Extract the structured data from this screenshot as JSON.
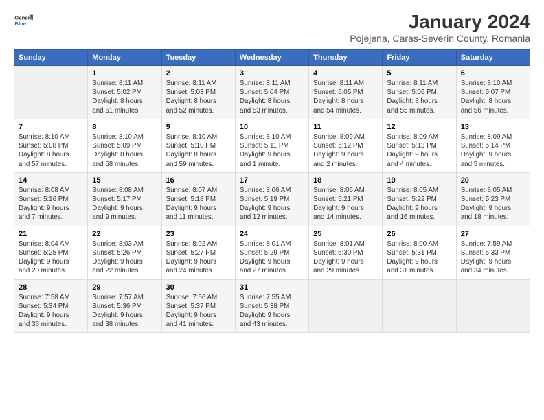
{
  "logo": {
    "general": "General",
    "blue": "Blue"
  },
  "title": "January 2024",
  "subtitle": "Pojejena, Caras-Severin County, Romania",
  "headers": [
    "Sunday",
    "Monday",
    "Tuesday",
    "Wednesday",
    "Thursday",
    "Friday",
    "Saturday"
  ],
  "weeks": [
    [
      {
        "num": "",
        "info": ""
      },
      {
        "num": "1",
        "info": "Sunrise: 8:11 AM\nSunset: 5:02 PM\nDaylight: 8 hours\nand 51 minutes."
      },
      {
        "num": "2",
        "info": "Sunrise: 8:11 AM\nSunset: 5:03 PM\nDaylight: 8 hours\nand 52 minutes."
      },
      {
        "num": "3",
        "info": "Sunrise: 8:11 AM\nSunset: 5:04 PM\nDaylight: 8 hours\nand 53 minutes."
      },
      {
        "num": "4",
        "info": "Sunrise: 8:11 AM\nSunset: 5:05 PM\nDaylight: 8 hours\nand 54 minutes."
      },
      {
        "num": "5",
        "info": "Sunrise: 8:11 AM\nSunset: 5:06 PM\nDaylight: 8 hours\nand 55 minutes."
      },
      {
        "num": "6",
        "info": "Sunrise: 8:10 AM\nSunset: 5:07 PM\nDaylight: 8 hours\nand 56 minutes."
      }
    ],
    [
      {
        "num": "7",
        "info": "Sunrise: 8:10 AM\nSunset: 5:08 PM\nDaylight: 8 hours\nand 57 minutes."
      },
      {
        "num": "8",
        "info": "Sunrise: 8:10 AM\nSunset: 5:09 PM\nDaylight: 8 hours\nand 58 minutes."
      },
      {
        "num": "9",
        "info": "Sunrise: 8:10 AM\nSunset: 5:10 PM\nDaylight: 8 hours\nand 59 minutes."
      },
      {
        "num": "10",
        "info": "Sunrise: 8:10 AM\nSunset: 5:11 PM\nDaylight: 9 hours\nand 1 minute."
      },
      {
        "num": "11",
        "info": "Sunrise: 8:09 AM\nSunset: 5:12 PM\nDaylight: 9 hours\nand 2 minutes."
      },
      {
        "num": "12",
        "info": "Sunrise: 8:09 AM\nSunset: 5:13 PM\nDaylight: 9 hours\nand 4 minutes."
      },
      {
        "num": "13",
        "info": "Sunrise: 8:09 AM\nSunset: 5:14 PM\nDaylight: 9 hours\nand 5 minutes."
      }
    ],
    [
      {
        "num": "14",
        "info": "Sunrise: 8:08 AM\nSunset: 5:16 PM\nDaylight: 9 hours\nand 7 minutes."
      },
      {
        "num": "15",
        "info": "Sunrise: 8:08 AM\nSunset: 5:17 PM\nDaylight: 9 hours\nand 9 minutes."
      },
      {
        "num": "16",
        "info": "Sunrise: 8:07 AM\nSunset: 5:18 PM\nDaylight: 9 hours\nand 11 minutes."
      },
      {
        "num": "17",
        "info": "Sunrise: 8:06 AM\nSunset: 5:19 PM\nDaylight: 9 hours\nand 12 minutes."
      },
      {
        "num": "18",
        "info": "Sunrise: 8:06 AM\nSunset: 5:21 PM\nDaylight: 9 hours\nand 14 minutes."
      },
      {
        "num": "19",
        "info": "Sunrise: 8:05 AM\nSunset: 5:22 PM\nDaylight: 9 hours\nand 16 minutes."
      },
      {
        "num": "20",
        "info": "Sunrise: 8:05 AM\nSunset: 5:23 PM\nDaylight: 9 hours\nand 18 minutes."
      }
    ],
    [
      {
        "num": "21",
        "info": "Sunrise: 8:04 AM\nSunset: 5:25 PM\nDaylight: 9 hours\nand 20 minutes."
      },
      {
        "num": "22",
        "info": "Sunrise: 8:03 AM\nSunset: 5:26 PM\nDaylight: 9 hours\nand 22 minutes."
      },
      {
        "num": "23",
        "info": "Sunrise: 8:02 AM\nSunset: 5:27 PM\nDaylight: 9 hours\nand 24 minutes."
      },
      {
        "num": "24",
        "info": "Sunrise: 8:01 AM\nSunset: 5:29 PM\nDaylight: 9 hours\nand 27 minutes."
      },
      {
        "num": "25",
        "info": "Sunrise: 8:01 AM\nSunset: 5:30 PM\nDaylight: 9 hours\nand 29 minutes."
      },
      {
        "num": "26",
        "info": "Sunrise: 8:00 AM\nSunset: 5:31 PM\nDaylight: 9 hours\nand 31 minutes."
      },
      {
        "num": "27",
        "info": "Sunrise: 7:59 AM\nSunset: 5:33 PM\nDaylight: 9 hours\nand 34 minutes."
      }
    ],
    [
      {
        "num": "28",
        "info": "Sunrise: 7:58 AM\nSunset: 5:34 PM\nDaylight: 9 hours\nand 36 minutes."
      },
      {
        "num": "29",
        "info": "Sunrise: 7:57 AM\nSunset: 5:36 PM\nDaylight: 9 hours\nand 38 minutes."
      },
      {
        "num": "30",
        "info": "Sunrise: 7:56 AM\nSunset: 5:37 PM\nDaylight: 9 hours\nand 41 minutes."
      },
      {
        "num": "31",
        "info": "Sunrise: 7:55 AM\nSunset: 5:38 PM\nDaylight: 9 hours\nand 43 minutes."
      },
      {
        "num": "",
        "info": ""
      },
      {
        "num": "",
        "info": ""
      },
      {
        "num": "",
        "info": ""
      }
    ]
  ]
}
